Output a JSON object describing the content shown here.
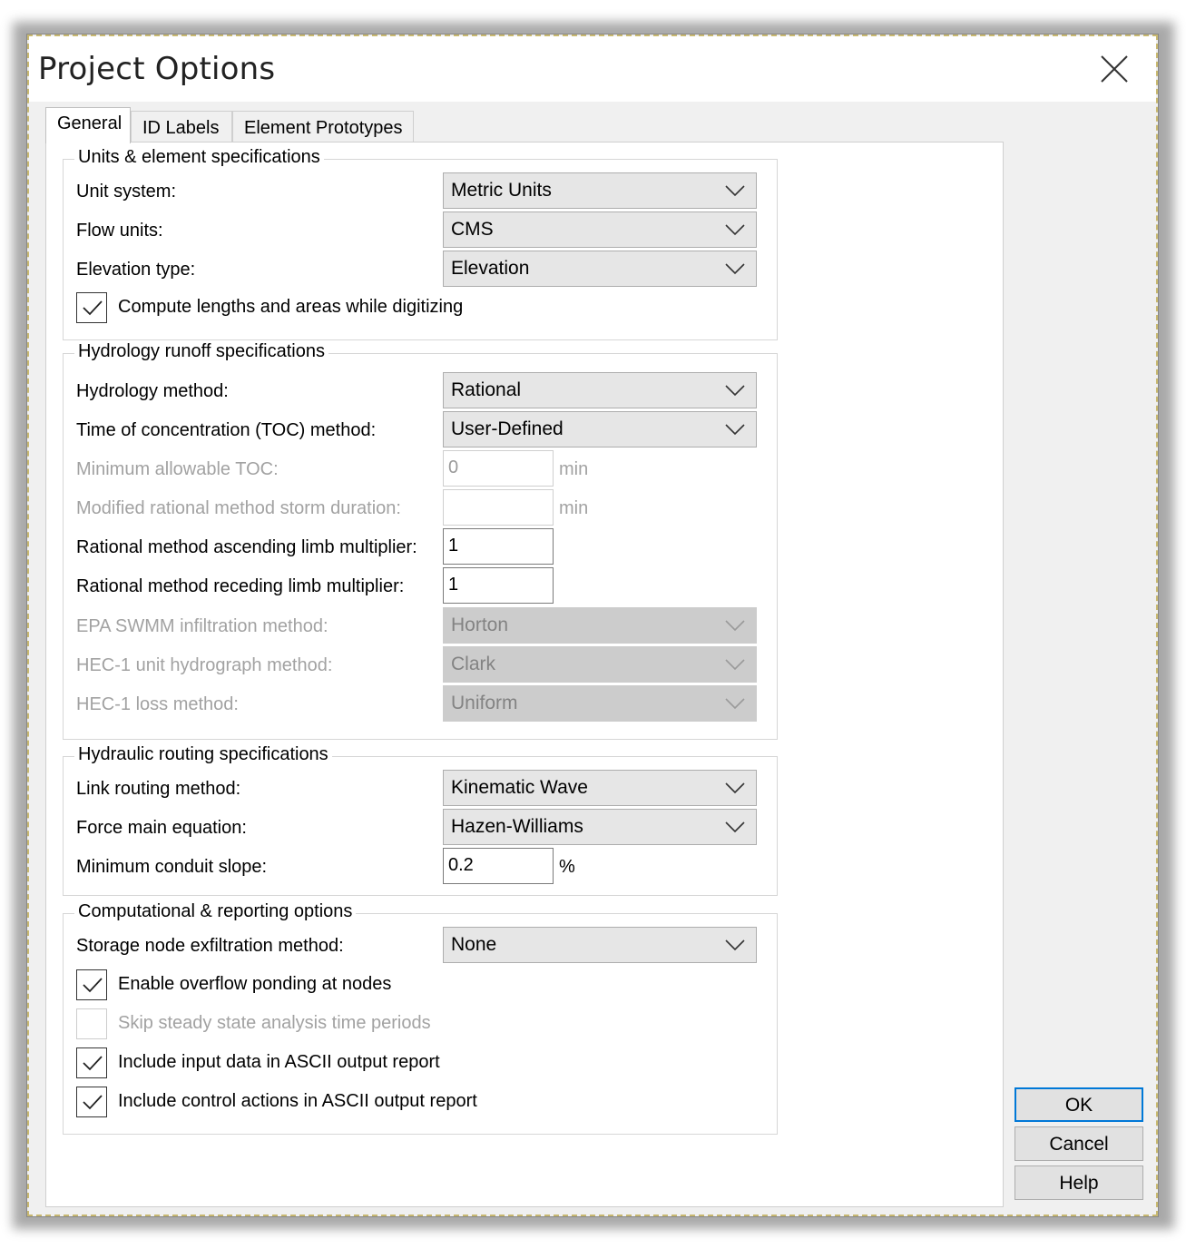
{
  "window": {
    "title": "Project Options"
  },
  "tabs": [
    {
      "label": "General"
    },
    {
      "label": "ID Labels"
    },
    {
      "label": "Element Prototypes"
    }
  ],
  "units_group": {
    "title": "Units & element specifications",
    "unit_system": {
      "label": "Unit system:",
      "value": "Metric Units"
    },
    "flow_units": {
      "label": "Flow units:",
      "value": "CMS"
    },
    "elevation_type": {
      "label": "Elevation type:",
      "value": "Elevation"
    },
    "compute_lengths": {
      "label": "Compute lengths and areas while digitizing",
      "checked": true
    }
  },
  "hydrology_group": {
    "title": "Hydrology runoff specifications",
    "method": {
      "label": "Hydrology method:",
      "value": "Rational"
    },
    "toc_method": {
      "label": "Time of concentration (TOC) method:",
      "value": "User-Defined"
    },
    "min_toc": {
      "label": "Minimum allowable TOC:",
      "value": "0",
      "unit": "min"
    },
    "storm_duration": {
      "label": "Modified rational method storm duration:",
      "value": "",
      "unit": "min"
    },
    "ascending_multiplier": {
      "label": "Rational method ascending limb multiplier:",
      "value": "1"
    },
    "receding_multiplier": {
      "label": "Rational method receding limb multiplier:",
      "value": "1"
    },
    "swmm_infiltration": {
      "label": "EPA SWMM infiltration method:",
      "value": "Horton"
    },
    "hec1_unit_hydrograph": {
      "label": "HEC-1 unit hydrograph method:",
      "value": "Clark"
    },
    "hec1_loss": {
      "label": "HEC-1 loss method:",
      "value": "Uniform"
    }
  },
  "hydraulic_group": {
    "title": "Hydraulic routing specifications",
    "link_routing": {
      "label": "Link routing method:",
      "value": "Kinematic Wave"
    },
    "force_main": {
      "label": "Force main equation:",
      "value": "Hazen-Williams"
    },
    "min_slope": {
      "label": "Minimum conduit slope:",
      "value": "0.2",
      "unit": "%"
    }
  },
  "computational_group": {
    "title": "Computational & reporting options",
    "storage_exfiltration": {
      "label": "Storage node exfiltration method:",
      "value": "None"
    },
    "overflow_ponding": {
      "label": "Enable overflow ponding at nodes",
      "checked": true
    },
    "skip_steady_state": {
      "label": "Skip steady state analysis time periods",
      "checked": false
    },
    "include_input_data": {
      "label": "Include input data in ASCII output report",
      "checked": true
    },
    "include_control_actions": {
      "label": "Include control actions in ASCII output report",
      "checked": true
    }
  },
  "buttons": {
    "ok": "OK",
    "cancel": "Cancel",
    "help": "Help"
  },
  "icons": {
    "close": "close-icon",
    "dropdown": "chevron-down-icon",
    "check": "checkmark-icon"
  },
  "colors": {
    "accent": "#0078d7",
    "dialog_bg": "#f0f0f0",
    "panel_bg": "#ffffff"
  }
}
